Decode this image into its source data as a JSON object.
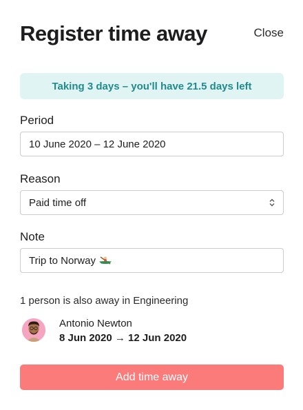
{
  "dialog": {
    "title": "Register time away",
    "close_label": "Close"
  },
  "banner": {
    "text": "Taking 3 days – you'll have 21.5 days left"
  },
  "period": {
    "label": "Period",
    "value": "10 June 2020 – 12 June 2020"
  },
  "reason": {
    "label": "Reason",
    "selected": "Paid time off"
  },
  "note": {
    "label": "Note",
    "value": "Trip to Norway",
    "icon": "rowing-boat-icon"
  },
  "also_away": {
    "text": "1 person is also away in Engineering",
    "people": [
      {
        "name": "Antonio Newton",
        "dates": "8 Jun 2020 → 12 Jun 2020"
      }
    ]
  },
  "submit": {
    "label": "Add time away"
  },
  "colors": {
    "banner_bg": "#e1f4f4",
    "banner_text": "#218a8c",
    "submit_bg": "#fb7b7b",
    "avatar_bg": "#f6a5c0"
  }
}
